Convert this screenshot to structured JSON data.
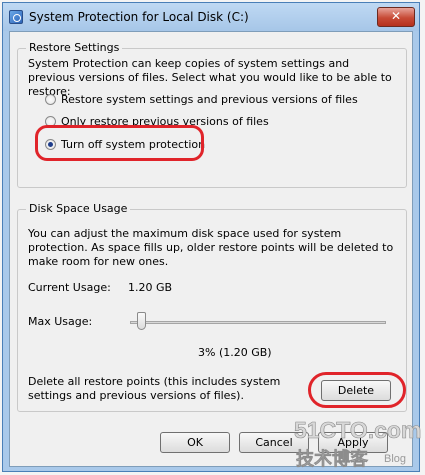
{
  "window": {
    "title": "System Protection for Local Disk (C:)",
    "close_glyph": "✕"
  },
  "restore_settings": {
    "label": "Restore Settings",
    "description": "System Protection can keep copies of system settings and previous versions of files. Select what you would like to be able to restore:",
    "options": [
      {
        "label": "Restore system settings and previous versions of files",
        "checked": false
      },
      {
        "label": "Only restore previous versions of files",
        "checked": false
      },
      {
        "label": "Turn off system protection",
        "checked": true
      }
    ]
  },
  "disk_space": {
    "label": "Disk Space Usage",
    "description": "You can adjust the maximum disk space used for system protection. As space fills up, older restore points will be deleted to make room for new ones.",
    "current_usage_label": "Current Usage:",
    "current_usage_value": "1.20 GB",
    "max_usage_label": "Max Usage:",
    "max_usage_percent": 3,
    "max_usage_readout": "3% (1.20 GB)",
    "delete_description": "Delete all restore points (this includes system settings and previous versions of files).",
    "delete_label": "Delete"
  },
  "buttons": {
    "ok_label": "OK",
    "cancel_label": "Cancel",
    "apply_label": "Apply"
  },
  "watermark": {
    "site": "51CTO.com",
    "sub": "技术博客",
    "blog": "Blog"
  },
  "colors": {
    "highlight": "#e0242a",
    "titlebar": "#a6c6e8"
  }
}
